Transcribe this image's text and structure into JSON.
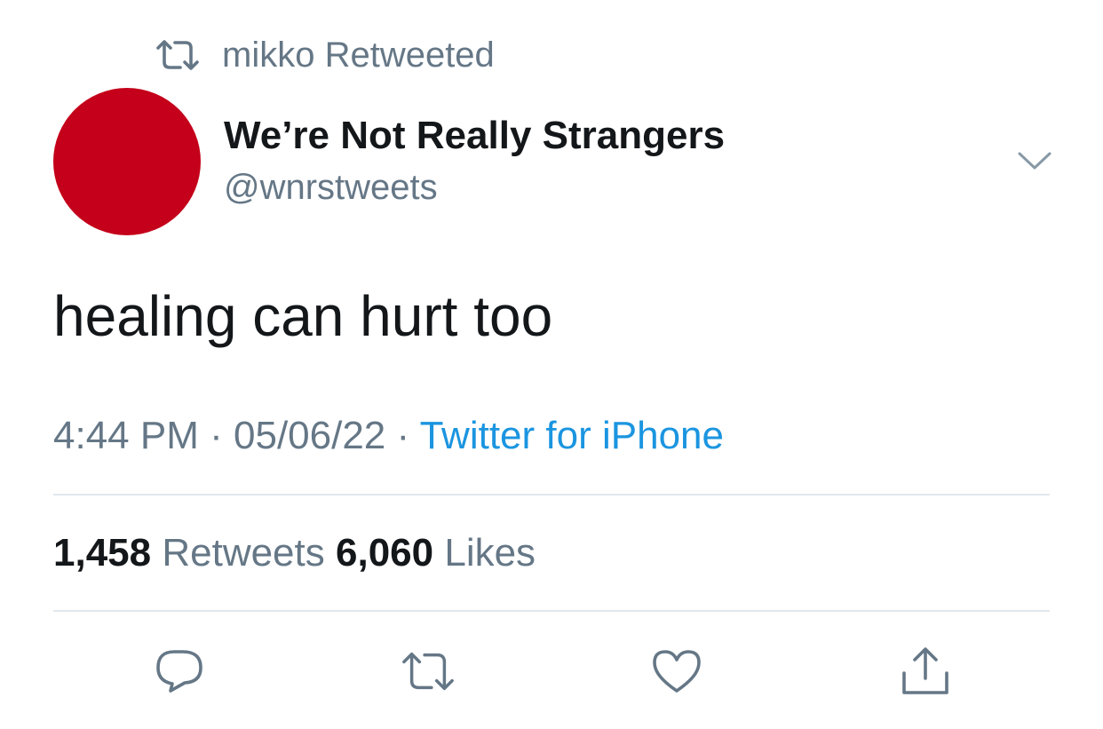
{
  "retweet_context": {
    "icon": "retweet-icon",
    "text": "mikko Retweeted"
  },
  "author": {
    "display_name": "We’re Not Really Strangers",
    "handle": "@wnrstweets",
    "avatar_color": "#c4001a"
  },
  "tweet": {
    "text": "healing can hurt too",
    "time": "4:44 PM",
    "separator": "·",
    "date": "05/06/22",
    "source": "Twitter for iPhone"
  },
  "stats": {
    "retweets_count": "1,458",
    "retweets_label": "Retweets",
    "likes_count": "6,060",
    "likes_label": "Likes"
  },
  "actions": [
    {
      "name": "reply",
      "icon": "reply-icon"
    },
    {
      "name": "retweet",
      "icon": "retweet-icon"
    },
    {
      "name": "like",
      "icon": "heart-icon"
    },
    {
      "name": "share",
      "icon": "share-icon"
    }
  ],
  "colors": {
    "text_primary": "#14171a",
    "text_secondary": "#657786",
    "link": "#1b95e0",
    "divider": "#e1e8ed",
    "icon": "#657786"
  }
}
